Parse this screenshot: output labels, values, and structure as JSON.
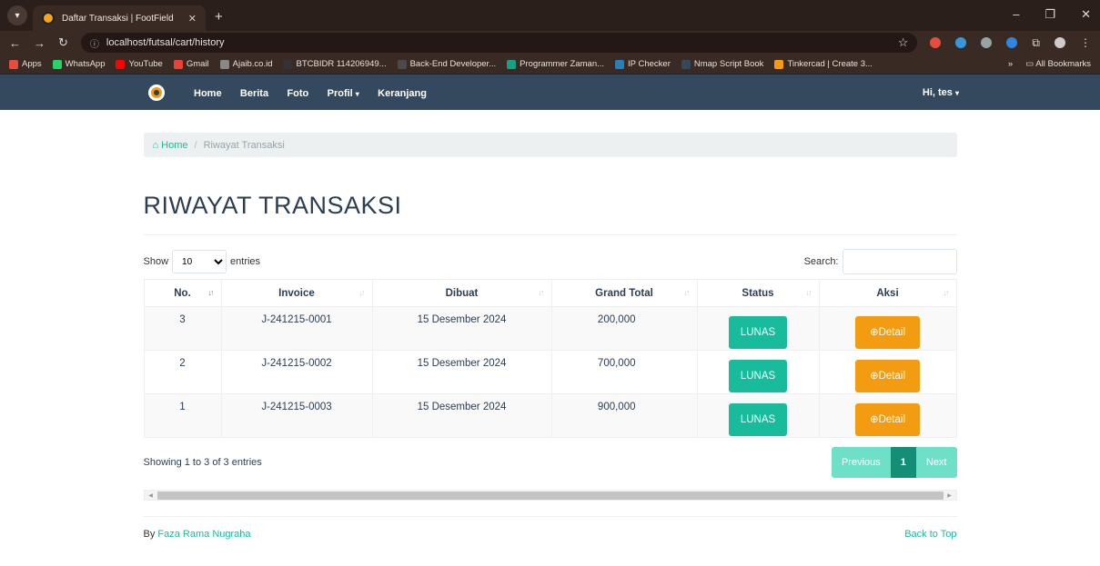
{
  "browser": {
    "tab_title": "Daftar Transaksi | FootField",
    "new_tab_symbol": "+",
    "url": "localhost/futsal/cart/history",
    "bookmarks": [
      {
        "label": "Apps",
        "color": "#e74c3c"
      },
      {
        "label": "WhatsApp",
        "color": "#25d366"
      },
      {
        "label": "YouTube",
        "color": "#ff0000"
      },
      {
        "label": "Gmail",
        "color": "#ea4335"
      },
      {
        "label": "Ajaib.co.id",
        "color": "#888888"
      },
      {
        "label": "BTCBIDR 114206949...",
        "color": "#333333"
      },
      {
        "label": "Back-End Developer...",
        "color": "#4a4a4a"
      },
      {
        "label": "Programmer Zaman...",
        "color": "#16a085"
      },
      {
        "label": "IP Checker",
        "color": "#2980b9"
      },
      {
        "label": "Nmap Script Book",
        "color": "#34495e"
      },
      {
        "label": "Tinkercad | Create 3...",
        "color": "#f39c12"
      }
    ],
    "overflow_label": "»",
    "all_bookmarks_label": "All Bookmarks"
  },
  "nav": {
    "home": "Home",
    "berita": "Berita",
    "foto": "Foto",
    "profil": "Profil",
    "keranjang": "Keranjang",
    "user": "Hi, tes"
  },
  "breadcrumb": {
    "home": "Home",
    "current": "Riwayat Transaksi"
  },
  "page_title": "RIWAYAT TRANSAKSI",
  "table_controls": {
    "show_label": "Show",
    "length_value": "10",
    "entries_label": "entries",
    "search_label": "Search:",
    "search_value": ""
  },
  "table": {
    "columns": [
      "No.",
      "Invoice",
      "Dibuat",
      "Grand Total",
      "Status",
      "Aksi"
    ],
    "rows": [
      {
        "no": "3",
        "invoice": "J-241215-0001",
        "dibuat": "15 Desember 2024",
        "total": "200,000",
        "status": "LUNAS",
        "action": "Detail"
      },
      {
        "no": "2",
        "invoice": "J-241215-0002",
        "dibuat": "15 Desember 2024",
        "total": "700,000",
        "status": "LUNAS",
        "action": "Detail"
      },
      {
        "no": "1",
        "invoice": "J-241215-0003",
        "dibuat": "15 Desember 2024",
        "total": "900,000",
        "status": "LUNAS",
        "action": "Detail"
      }
    ]
  },
  "table_footer": {
    "info": "Showing 1 to 3 of 3 entries",
    "previous": "Previous",
    "current_page": "1",
    "next": "Next"
  },
  "footer": {
    "by_label": "By",
    "author": "Faza Rama Nugraha",
    "back_to_top": "Back to Top"
  },
  "colors": {
    "navbar": "#35495e",
    "success": "#18bc9c",
    "warning": "#f39c12"
  }
}
